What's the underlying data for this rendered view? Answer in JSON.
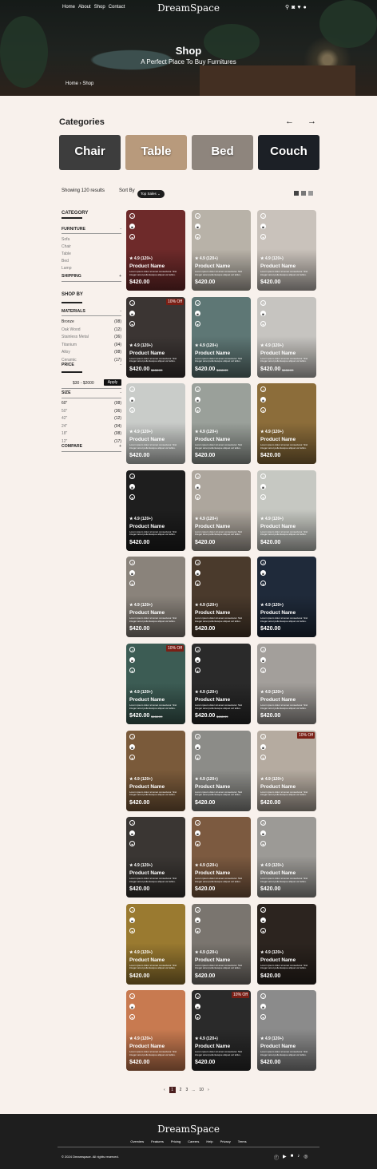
{
  "nav": {
    "links": [
      "Home",
      "About",
      "Shop",
      "Contact"
    ],
    "logo": "DreamSpace",
    "icons": [
      "search-icon",
      "cart-icon",
      "heart-icon",
      "user-icon"
    ]
  },
  "hero": {
    "title": "Shop",
    "subtitle": "A Perfect Place To Buy Furnitures",
    "breadcrumb": "Home › Shop"
  },
  "categories": {
    "title": "Categories",
    "items": [
      {
        "label": "Chair",
        "color": "#3d3d3d"
      },
      {
        "label": "Table",
        "color": "#b89a7c"
      },
      {
        "label": "Bed",
        "color": "#8e857d"
      },
      {
        "label": "Couch",
        "color": "#1c2026"
      }
    ]
  },
  "toolbar": {
    "results": "Showing 120 results",
    "sort_label": "Sort By",
    "sort_value": "Top Sales"
  },
  "sidebar": {
    "category_heading": "CATEGORY",
    "furniture": {
      "label": "FURNITURE",
      "symbol": "-",
      "items": [
        "Sofa",
        "Chair",
        "Table",
        "Bed",
        "Lamp"
      ]
    },
    "shipping": {
      "label": "SHIPPING",
      "symbol": "+"
    },
    "shopby_heading": "SHOP BY",
    "materials": {
      "label": "MATERIALS",
      "symbol": "-",
      "items": [
        {
          "name": "Bronze",
          "count": "(08)"
        },
        {
          "name": "Oak Wood",
          "count": "(12)"
        },
        {
          "name": "Stainless Metal",
          "count": "(36)"
        },
        {
          "name": "Titanium",
          "count": "(04)"
        },
        {
          "name": "Alloy",
          "count": "(08)"
        },
        {
          "name": "Ceramic",
          "count": "(17)"
        }
      ]
    },
    "price": {
      "label": "PRICE",
      "symbol": "-",
      "range": "$30 - $2000",
      "apply": "Apply"
    },
    "size": {
      "label": "SIZE",
      "symbol": "-",
      "items": [
        {
          "name": "60\"",
          "count": "(08)"
        },
        {
          "name": "50\"",
          "count": "(36)"
        },
        {
          "name": "42\"",
          "count": "(12)"
        },
        {
          "name": "24\"",
          "count": "(04)"
        },
        {
          "name": "18\"",
          "count": "(08)"
        },
        {
          "name": "12\"",
          "count": "(17)"
        }
      ]
    },
    "compare": {
      "label": "COMPARE",
      "symbol": "+"
    }
  },
  "product_template": {
    "rating": "★ 4.9 (120+)",
    "name": "Product Name",
    "desc": "Lorem ipsum dolor sit amet consectetur. Nisl integer amet pellentesque aliquet vel tellus.",
    "price": "$420.00"
  },
  "products": [
    {
      "color": "#6e2a2a"
    },
    {
      "color": "#b8b2a8"
    },
    {
      "color": "#c9c2bb"
    },
    {
      "color": "#3b3533",
      "badge": "10% Off",
      "old": "$468.09"
    },
    {
      "color": "#5e7775",
      "old": "$468.09"
    },
    {
      "color": "#c6c4c0",
      "old": "$468.09"
    },
    {
      "color": "#c9ccc9"
    },
    {
      "color": "#9aa09a"
    },
    {
      "color": "#8c6d3a"
    },
    {
      "color": "#1e1e1e"
    },
    {
      "color": "#ada69d"
    },
    {
      "color": "#c6c8c2"
    },
    {
      "color": "#8a837b"
    },
    {
      "color": "#4a3a2c"
    },
    {
      "color": "#1f2a3a"
    },
    {
      "color": "#3c5c54",
      "badge": "10% Off",
      "old": "$468.09"
    },
    {
      "color": "#2a2a2a",
      "old": "$468.09"
    },
    {
      "color": "#a39f9b"
    },
    {
      "color": "#7a5a3a"
    },
    {
      "color": "#8c8c88"
    },
    {
      "color": "#b5aba0",
      "badge": "10% Off"
    },
    {
      "color": "#3a3633"
    },
    {
      "color": "#7c5a40"
    },
    {
      "color": "#9c9a96"
    },
    {
      "color": "#9a7a30"
    },
    {
      "color": "#7a756f"
    },
    {
      "color": "#2c241f"
    },
    {
      "color": "#c87a50"
    },
    {
      "color": "#2a2a2a",
      "badge": "10% Off"
    },
    {
      "color": "#8b8b8b"
    }
  ],
  "pagination": {
    "prev": "‹",
    "pages": [
      "1",
      "2",
      "3",
      "...",
      "10"
    ],
    "next": "›"
  },
  "footer": {
    "logo": "DreamSpace",
    "links": [
      "Overview",
      "Features",
      "Pricing",
      "Careers",
      "Help",
      "Privacy",
      "Terms"
    ],
    "copyright": "© 2024 Dreamspace. All rights reserved.",
    "social": [
      "facebook-icon",
      "youtube-icon",
      "linkedin-icon",
      "tiktok-icon",
      "instagram-icon"
    ]
  }
}
